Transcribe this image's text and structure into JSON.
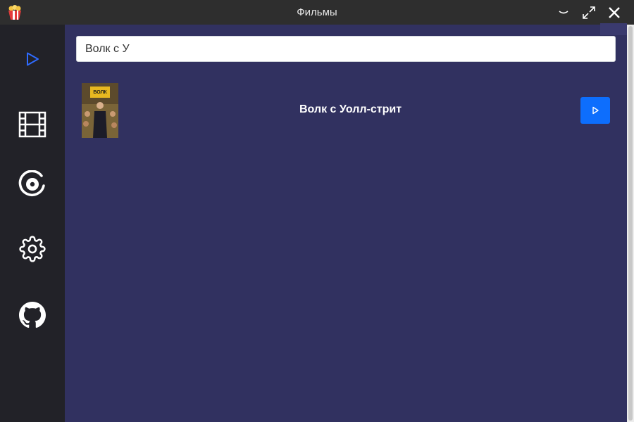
{
  "window": {
    "title": "Фильмы",
    "icons": {
      "logo": "popcorn-icon",
      "minimize": "chevron-down-icon",
      "maximize": "expand-icon",
      "close": "close-icon"
    }
  },
  "sidebar": {
    "items": [
      {
        "id": "player",
        "icon": "play-icon",
        "active": true
      },
      {
        "id": "films",
        "icon": "film-icon"
      },
      {
        "id": "disc",
        "icon": "disc-icon"
      },
      {
        "id": "settings",
        "icon": "gear-icon"
      },
      {
        "id": "github",
        "icon": "github-icon"
      }
    ]
  },
  "search": {
    "value": "Волк с У"
  },
  "results": [
    {
      "title": "Волк с Уолл-стрит",
      "poster_text": "ВОЛК"
    }
  ],
  "colors": {
    "background": "#313160",
    "sidebar": "#222228",
    "titlebar": "#2e2e2e",
    "accent": "#0d6efd",
    "active_icon": "#2f6bff"
  }
}
